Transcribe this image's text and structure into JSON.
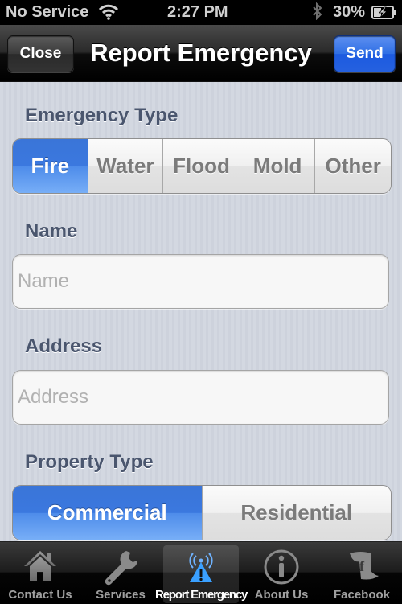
{
  "status_bar": {
    "carrier": "No Service",
    "time": "2:27 PM",
    "battery_percent": "30%",
    "icons": [
      "wifi-icon",
      "bluetooth-icon",
      "battery-charging-icon"
    ]
  },
  "nav_bar": {
    "title": "Report Emergency",
    "left_button": "Close",
    "right_button": "Send",
    "accent_color": "#2f6fe5"
  },
  "form": {
    "emergency_type": {
      "label": "Emergency Type",
      "options": [
        "Fire",
        "Water",
        "Flood",
        "Mold",
        "Other"
      ],
      "selected": "Fire"
    },
    "name": {
      "label": "Name",
      "value": "",
      "placeholder": "Name"
    },
    "address": {
      "label": "Address",
      "value": "",
      "placeholder": "Address"
    },
    "property_type": {
      "label": "Property Type",
      "options": [
        "Commercial",
        "Residential"
      ],
      "selected": "Commercial"
    }
  },
  "tab_bar": {
    "items": [
      {
        "label": "Contact Us",
        "icon": "house-icon"
      },
      {
        "label": "Services",
        "icon": "wrench-icon"
      },
      {
        "label": "Report Emergency",
        "icon": "alert-beacon-icon",
        "active": true
      },
      {
        "label": "About Us",
        "icon": "info-icon"
      },
      {
        "label": "Facebook",
        "icon": "facebook-icon"
      }
    ]
  }
}
